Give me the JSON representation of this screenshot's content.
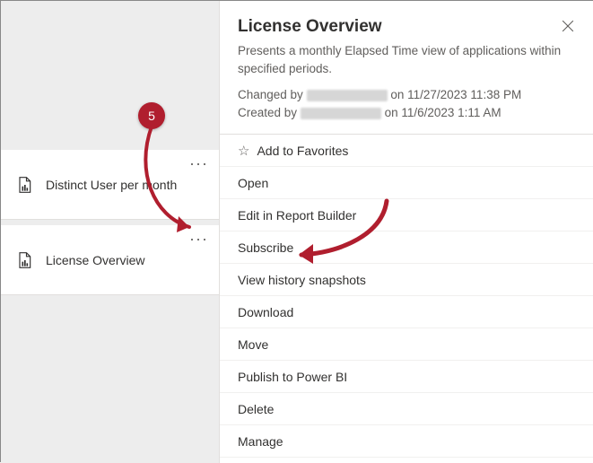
{
  "annotation": {
    "step_number": "5"
  },
  "reports": [
    {
      "label": "Distinct User per month"
    },
    {
      "label": "License Overview"
    }
  ],
  "panel": {
    "title": "License Overview",
    "description": "Presents a monthly Elapsed Time view of applications within specified periods.",
    "changed_prefix": "Changed by",
    "changed_date": "on 11/27/2023 11:38 PM",
    "created_prefix": "Created by",
    "created_date": "on 11/6/2023 1:11 AM"
  },
  "menu": {
    "add_favorites": "Add to Favorites",
    "open": "Open",
    "edit": "Edit in Report Builder",
    "subscribe": "Subscribe",
    "view_history": "View history snapshots",
    "download": "Download",
    "move": "Move",
    "publish": "Publish to Power BI",
    "delete": "Delete",
    "manage": "Manage"
  }
}
